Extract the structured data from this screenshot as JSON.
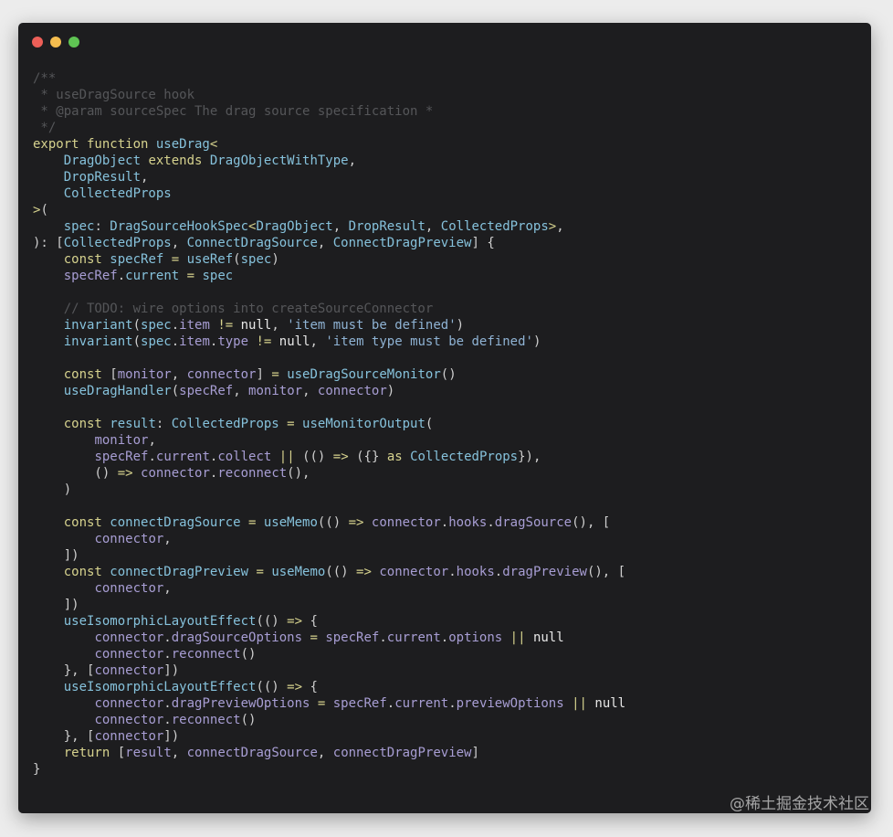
{
  "window": {
    "traffic_lights": {
      "close": "#ed5f58",
      "minimize": "#f5bd4f",
      "maximize": "#5fc453"
    }
  },
  "watermark": "@稀土掘金技术社区",
  "code_lines": [
    [
      [
        "c",
        "/**"
      ]
    ],
    [
      [
        "c",
        " * useDragSource hook"
      ]
    ],
    [
      [
        "c",
        " * @param sourceSpec The drag source specification *"
      ]
    ],
    [
      [
        "c",
        " */"
      ]
    ],
    [
      [
        "k",
        "export function "
      ],
      [
        "t",
        "useDrag"
      ],
      [
        "o",
        "<"
      ]
    ],
    [
      [
        "p",
        "    "
      ],
      [
        "t",
        "DragObject "
      ],
      [
        "k",
        "extends "
      ],
      [
        "t",
        "DragObjectWithType"
      ],
      [
        "p",
        ","
      ]
    ],
    [
      [
        "p",
        "    "
      ],
      [
        "t",
        "DropResult"
      ],
      [
        "p",
        ","
      ]
    ],
    [
      [
        "p",
        "    "
      ],
      [
        "t",
        "CollectedProps"
      ]
    ],
    [
      [
        "o",
        ">"
      ],
      [
        "p",
        "("
      ]
    ],
    [
      [
        "p",
        "    "
      ],
      [
        "t",
        "spec"
      ],
      [
        "p",
        ": "
      ],
      [
        "t",
        "DragSourceHookSpec"
      ],
      [
        "o",
        "<"
      ],
      [
        "t",
        "DragObject"
      ],
      [
        "p",
        ", "
      ],
      [
        "t",
        "DropResult"
      ],
      [
        "p",
        ", "
      ],
      [
        "t",
        "CollectedProps"
      ],
      [
        "o",
        ">"
      ],
      [
        "p",
        ","
      ]
    ],
    [
      [
        "p",
        "): ["
      ],
      [
        "t",
        "CollectedProps"
      ],
      [
        "p",
        ", "
      ],
      [
        "t",
        "ConnectDragSource"
      ],
      [
        "p",
        ", "
      ],
      [
        "t",
        "ConnectDragPreview"
      ],
      [
        "p",
        "] {"
      ]
    ],
    [
      [
        "p",
        "    "
      ],
      [
        "k",
        "const "
      ],
      [
        "t",
        "specRef "
      ],
      [
        "o",
        "= "
      ],
      [
        "t",
        "useRef"
      ],
      [
        "p",
        "("
      ],
      [
        "t",
        "spec"
      ],
      [
        "p",
        ")"
      ]
    ],
    [
      [
        "p",
        "    "
      ],
      [
        "v",
        "specRef"
      ],
      [
        "p",
        "."
      ],
      [
        "t",
        "current "
      ],
      [
        "o",
        "= "
      ],
      [
        "t",
        "spec"
      ]
    ],
    [
      [
        "p",
        ""
      ]
    ],
    [
      [
        "c",
        "    // TODO: wire options into createSourceConnector"
      ]
    ],
    [
      [
        "p",
        "    "
      ],
      [
        "t",
        "invariant"
      ],
      [
        "p",
        "("
      ],
      [
        "t",
        "spec"
      ],
      [
        "p",
        "."
      ],
      [
        "v",
        "item "
      ],
      [
        "o",
        "!= "
      ],
      [
        "n",
        "null"
      ],
      [
        "p",
        ", "
      ],
      [
        "s",
        "'item must be defined'"
      ],
      [
        "p",
        ")"
      ]
    ],
    [
      [
        "p",
        "    "
      ],
      [
        "t",
        "invariant"
      ],
      [
        "p",
        "("
      ],
      [
        "t",
        "spec"
      ],
      [
        "p",
        "."
      ],
      [
        "v",
        "item"
      ],
      [
        "p",
        "."
      ],
      [
        "v",
        "type "
      ],
      [
        "o",
        "!= "
      ],
      [
        "n",
        "null"
      ],
      [
        "p",
        ", "
      ],
      [
        "s",
        "'item type must be defined'"
      ],
      [
        "p",
        ")"
      ]
    ],
    [
      [
        "p",
        ""
      ]
    ],
    [
      [
        "p",
        "    "
      ],
      [
        "k",
        "const "
      ],
      [
        "p",
        "["
      ],
      [
        "v",
        "monitor"
      ],
      [
        "p",
        ", "
      ],
      [
        "v",
        "connector"
      ],
      [
        "p",
        "] "
      ],
      [
        "o",
        "= "
      ],
      [
        "t",
        "useDragSourceMonitor"
      ],
      [
        "p",
        "()"
      ]
    ],
    [
      [
        "p",
        "    "
      ],
      [
        "t",
        "useDragHandler"
      ],
      [
        "p",
        "("
      ],
      [
        "v",
        "specRef"
      ],
      [
        "p",
        ", "
      ],
      [
        "v",
        "monitor"
      ],
      [
        "p",
        ", "
      ],
      [
        "v",
        "connector"
      ],
      [
        "p",
        ")"
      ]
    ],
    [
      [
        "p",
        ""
      ]
    ],
    [
      [
        "p",
        "    "
      ],
      [
        "k",
        "const "
      ],
      [
        "t",
        "result"
      ],
      [
        "p",
        ": "
      ],
      [
        "t",
        "CollectedProps "
      ],
      [
        "o",
        "= "
      ],
      [
        "t",
        "useMonitorOutput"
      ],
      [
        "p",
        "("
      ]
    ],
    [
      [
        "p",
        "        "
      ],
      [
        "v",
        "monitor"
      ],
      [
        "p",
        ","
      ]
    ],
    [
      [
        "p",
        "        "
      ],
      [
        "v",
        "specRef"
      ],
      [
        "p",
        "."
      ],
      [
        "v",
        "current"
      ],
      [
        "p",
        "."
      ],
      [
        "v",
        "collect "
      ],
      [
        "o",
        "|| "
      ],
      [
        "p",
        "(() "
      ],
      [
        "o",
        "=> "
      ],
      [
        "p",
        "({} "
      ],
      [
        "k",
        "as "
      ],
      [
        "t",
        "CollectedProps"
      ],
      [
        "p",
        "}),"
      ]
    ],
    [
      [
        "p",
        "        () "
      ],
      [
        "o",
        "=> "
      ],
      [
        "v",
        "connector"
      ],
      [
        "p",
        "."
      ],
      [
        "v",
        "reconnect"
      ],
      [
        "p",
        "(),"
      ]
    ],
    [
      [
        "p",
        "    )"
      ]
    ],
    [
      [
        "p",
        ""
      ]
    ],
    [
      [
        "p",
        "    "
      ],
      [
        "k",
        "const "
      ],
      [
        "t",
        "connectDragSource "
      ],
      [
        "o",
        "= "
      ],
      [
        "t",
        "useMemo"
      ],
      [
        "p",
        "(() "
      ],
      [
        "o",
        "=> "
      ],
      [
        "v",
        "connector"
      ],
      [
        "p",
        "."
      ],
      [
        "v",
        "hooks"
      ],
      [
        "p",
        "."
      ],
      [
        "v",
        "dragSource"
      ],
      [
        "p",
        "(), ["
      ]
    ],
    [
      [
        "p",
        "        "
      ],
      [
        "v",
        "connector"
      ],
      [
        "p",
        ","
      ]
    ],
    [
      [
        "p",
        "    ])"
      ]
    ],
    [
      [
        "p",
        "    "
      ],
      [
        "k",
        "const "
      ],
      [
        "t",
        "connectDragPreview "
      ],
      [
        "o",
        "= "
      ],
      [
        "t",
        "useMemo"
      ],
      [
        "p",
        "(() "
      ],
      [
        "o",
        "=> "
      ],
      [
        "v",
        "connector"
      ],
      [
        "p",
        "."
      ],
      [
        "v",
        "hooks"
      ],
      [
        "p",
        "."
      ],
      [
        "v",
        "dragPreview"
      ],
      [
        "p",
        "(), ["
      ]
    ],
    [
      [
        "p",
        "        "
      ],
      [
        "v",
        "connector"
      ],
      [
        "p",
        ","
      ]
    ],
    [
      [
        "p",
        "    ])"
      ]
    ],
    [
      [
        "p",
        "    "
      ],
      [
        "t",
        "useIsomorphicLayoutEffect"
      ],
      [
        "p",
        "(() "
      ],
      [
        "o",
        "=> "
      ],
      [
        "p",
        "{"
      ]
    ],
    [
      [
        "p",
        "        "
      ],
      [
        "v",
        "connector"
      ],
      [
        "p",
        "."
      ],
      [
        "v",
        "dragSourceOptions "
      ],
      [
        "o",
        "= "
      ],
      [
        "v",
        "specRef"
      ],
      [
        "p",
        "."
      ],
      [
        "v",
        "current"
      ],
      [
        "p",
        "."
      ],
      [
        "v",
        "options "
      ],
      [
        "o",
        "|| "
      ],
      [
        "n",
        "null"
      ]
    ],
    [
      [
        "p",
        "        "
      ],
      [
        "v",
        "connector"
      ],
      [
        "p",
        "."
      ],
      [
        "v",
        "reconnect"
      ],
      [
        "p",
        "()"
      ]
    ],
    [
      [
        "p",
        "    }, ["
      ],
      [
        "v",
        "connector"
      ],
      [
        "p",
        "])"
      ]
    ],
    [
      [
        "p",
        "    "
      ],
      [
        "t",
        "useIsomorphicLayoutEffect"
      ],
      [
        "p",
        "(() "
      ],
      [
        "o",
        "=> "
      ],
      [
        "p",
        "{"
      ]
    ],
    [
      [
        "p",
        "        "
      ],
      [
        "v",
        "connector"
      ],
      [
        "p",
        "."
      ],
      [
        "v",
        "dragPreviewOptions "
      ],
      [
        "o",
        "= "
      ],
      [
        "v",
        "specRef"
      ],
      [
        "p",
        "."
      ],
      [
        "v",
        "current"
      ],
      [
        "p",
        "."
      ],
      [
        "v",
        "previewOptions "
      ],
      [
        "o",
        "|| "
      ],
      [
        "n",
        "null"
      ]
    ],
    [
      [
        "p",
        "        "
      ],
      [
        "v",
        "connector"
      ],
      [
        "p",
        "."
      ],
      [
        "v",
        "reconnect"
      ],
      [
        "p",
        "()"
      ]
    ],
    [
      [
        "p",
        "    }, ["
      ],
      [
        "v",
        "connector"
      ],
      [
        "p",
        "])"
      ]
    ],
    [
      [
        "p",
        "    "
      ],
      [
        "k",
        "return "
      ],
      [
        "p",
        "["
      ],
      [
        "v",
        "result"
      ],
      [
        "p",
        ", "
      ],
      [
        "v",
        "connectDragSource"
      ],
      [
        "p",
        ", "
      ],
      [
        "v",
        "connectDragPreview"
      ],
      [
        "p",
        "]"
      ]
    ],
    [
      [
        "p",
        "}"
      ]
    ]
  ]
}
